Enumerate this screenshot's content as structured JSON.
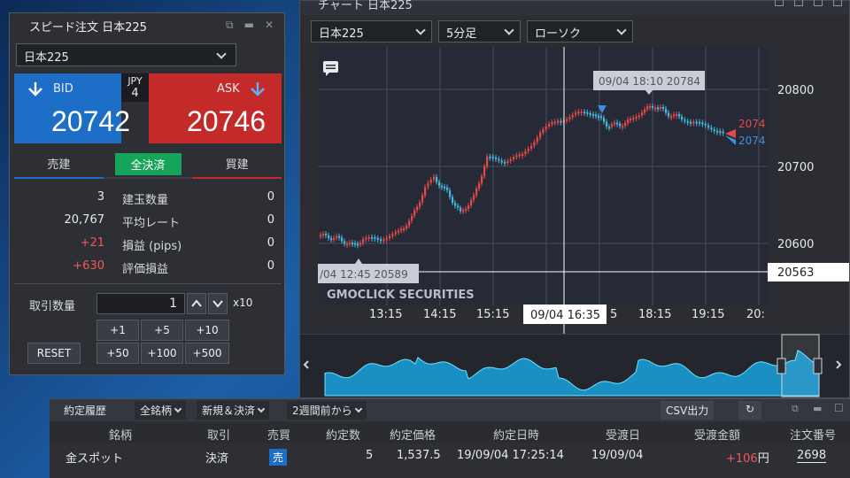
{
  "chart_window": {
    "title": "チャート 日本225",
    "symbol": "日本225",
    "interval": "5分足",
    "chart_style": "ローソク",
    "price_axis": [
      "20800",
      "20700",
      "20600"
    ],
    "time_axis": [
      "13:15",
      "14:15",
      "15:15",
      "5",
      "18:15",
      "19:15",
      "20:"
    ],
    "crosshair_price": "20563",
    "crosshair_time": "09/04 16:35",
    "tooltip_high": "09/04 18:10 20784",
    "tooltip_low": "/04 12:45 20589",
    "ask_marker": "2074",
    "bid_marker": "2074",
    "watermark": "GMOCLICK SECURITIES",
    "colors": {
      "up": "#e84848",
      "down": "#45b8e0",
      "ask": "#e84848",
      "bid": "#3f8fe0"
    }
  },
  "order_panel": {
    "title": "スピード注文 日本225",
    "symbol": "日本225",
    "bid_label": "BID",
    "ask_label": "ASK",
    "bid_price": "20742",
    "ask_price": "20746",
    "currency": "JPY",
    "spread": "4",
    "tabs": {
      "sell_open": "売建",
      "close_all": "全決済",
      "buy_open": "買建"
    },
    "stats": [
      {
        "left": "3",
        "label": "建玉数量",
        "right": "0"
      },
      {
        "left": "20,767",
        "label": "平均レート",
        "right": "0"
      },
      {
        "left": "+21",
        "label": "損益 (pips)",
        "right": "0"
      },
      {
        "left": "+630",
        "label": "評価損益",
        "right": "0"
      }
    ],
    "qty_label": "取引数量",
    "qty_value": "1",
    "multiplier": "x10",
    "qty_buttons": [
      "+1",
      "+5",
      "+10",
      "+50",
      "+100",
      "+500"
    ],
    "reset": "RESET"
  },
  "history_panel": {
    "title": "約定履歴",
    "filter_symbol": "全銘柄",
    "filter_type": "新規＆決済",
    "filter_period": "2週間前から",
    "csv": "CSV出力",
    "columns": [
      "銘柄",
      "取引",
      "売買",
      "約定数",
      "約定価格",
      "約定日時",
      "受渡日",
      "受渡金額",
      "注文番号"
    ],
    "row": {
      "symbol": "金スポット",
      "trade": "決済",
      "side": "売",
      "qty": "5",
      "price": "1,537.5",
      "datetime": "19/09/04 17:25:14",
      "settle_date": "19/09/04",
      "amount": "+106",
      "amount_unit": "円",
      "order_no": "2698"
    }
  }
}
